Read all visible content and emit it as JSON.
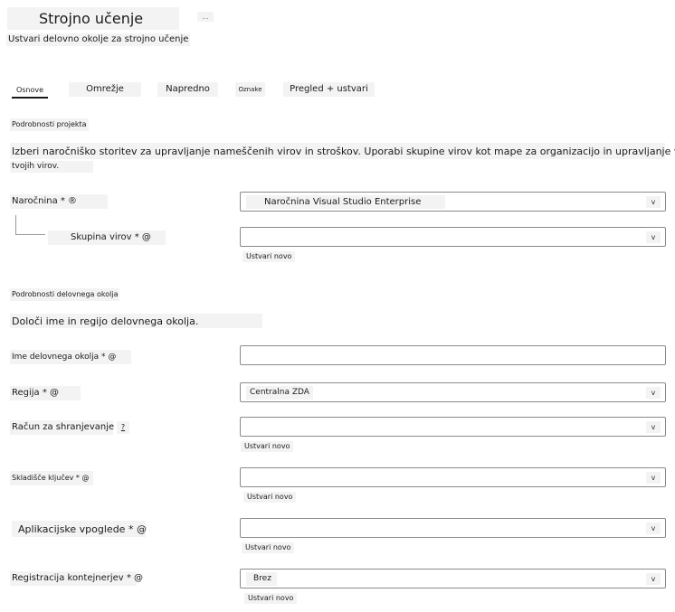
{
  "header": {
    "title": "Strojno učenje",
    "more_label": "...",
    "subtitle": "Ustvari delovno okolje za strojno učenje"
  },
  "tabs": [
    {
      "label": "Osnove",
      "active": true
    },
    {
      "label": "Omrežje",
      "active": false
    },
    {
      "label": "Napredno",
      "active": false
    },
    {
      "label": "Oznake",
      "active": false
    },
    {
      "label": "Pregled + ustvari",
      "active": false
    }
  ],
  "project": {
    "heading": "Podrobnosti projekta",
    "description_line1": "Izberi naročniško storitev za upravljanje nameščenih virov in stroškov. Uporabi skupine virov kot mape za organizacijo in upravljanje vseh",
    "description_line2": "tvojih virov.",
    "subscription_label": "Naročnina * ®",
    "subscription_value": "Naročnina Visual Studio Enterprise",
    "resource_group_label": "Skupina virov * @",
    "resource_group_value": "",
    "create_new": "Ustvari novo"
  },
  "workspace": {
    "heading": "Podrobnosti delovnega okolja",
    "description": "Določi ime in regijo delovnega okolja.",
    "name_label": "Ime delovnega okolja * @",
    "name_value": "",
    "region_label": "Regija * @",
    "region_value": "Centralna ZDA",
    "storage_label": "Račun za shranjevanje *",
    "storage_info": "?",
    "storage_value": "",
    "keyvault_label": "Skladišče ključev * @",
    "keyvault_value": "",
    "appinsights_label": "Aplikacijske vpoglede * @",
    "appinsights_value": "",
    "registry_label": "Registracija kontejnerjev * @",
    "registry_value": "Brez",
    "create_new": "Ustvari novo"
  },
  "icons": {
    "chevron": "v",
    "chevron_icon_name": "chevron-down-icon"
  }
}
